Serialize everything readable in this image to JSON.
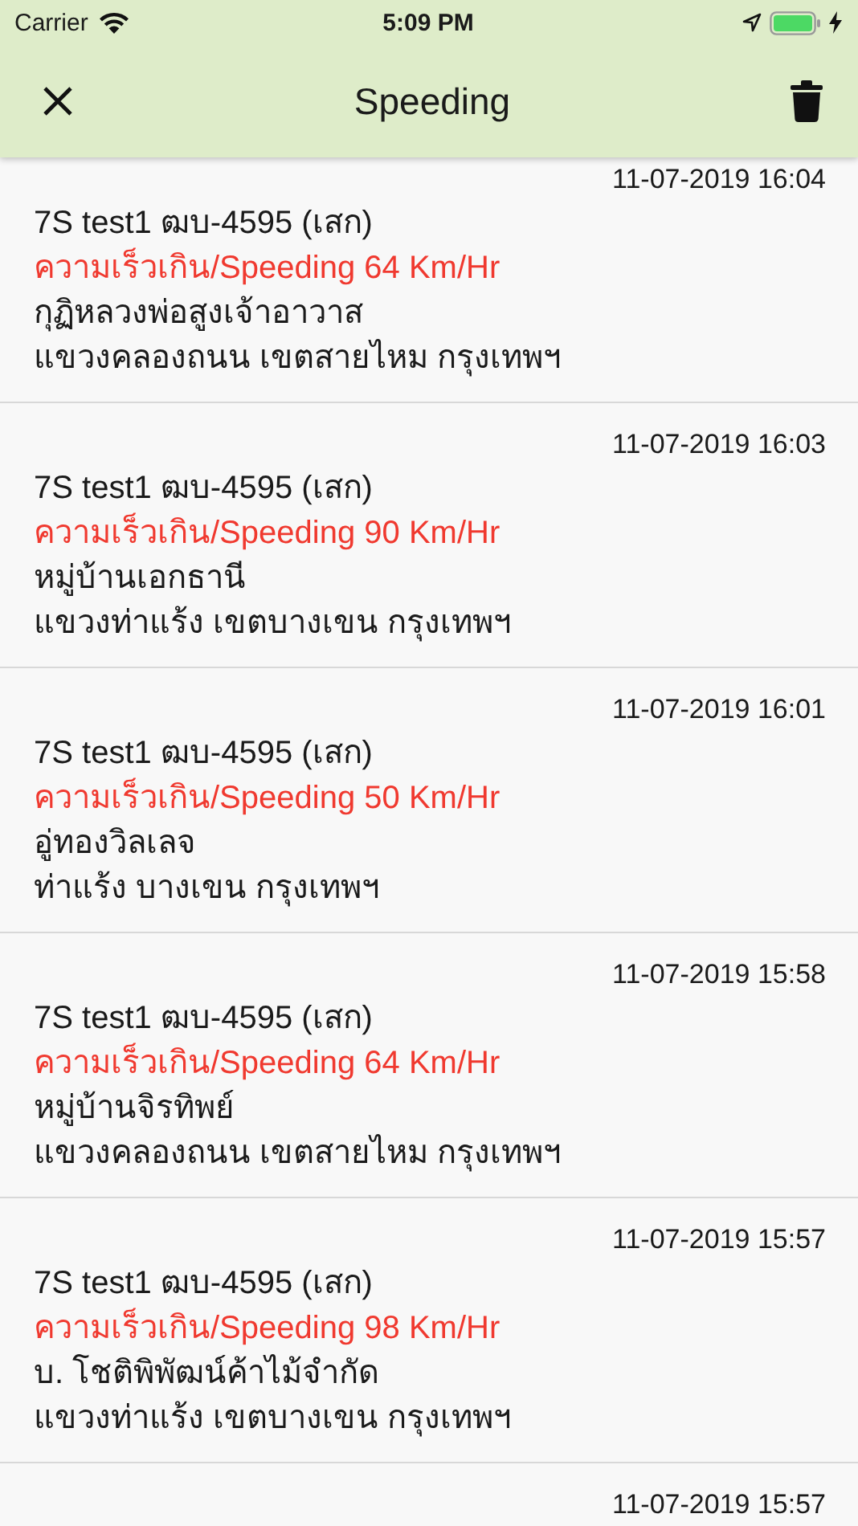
{
  "status_bar": {
    "carrier": "Carrier",
    "time": "5:09 PM"
  },
  "nav": {
    "title": "Speeding"
  },
  "alerts": [
    {
      "time": "11-07-2019 16:04",
      "vehicle": "7S test1 ฒบ-4595 (เสก)",
      "event": "ความเร็วเกิน/Speeding 64 Km/Hr",
      "place": "กุฏิหลวงพ่อสูงเจ้าอาวาส",
      "area": "แขวงคลองถนน เขตสายไหม กรุงเทพฯ"
    },
    {
      "time": "11-07-2019 16:03",
      "vehicle": "7S test1 ฒบ-4595 (เสก)",
      "event": "ความเร็วเกิน/Speeding 90 Km/Hr",
      "place": "หมู่บ้านเอกธานี",
      "area": "แขวงท่าแร้ง เขตบางเขน กรุงเทพฯ"
    },
    {
      "time": "11-07-2019 16:01",
      "vehicle": "7S test1 ฒบ-4595 (เสก)",
      "event": "ความเร็วเกิน/Speeding 50 Km/Hr",
      "place": "อู่ทองวิลเลจ",
      "area": "ท่าแร้ง บางเขน กรุงเทพฯ"
    },
    {
      "time": "11-07-2019 15:58",
      "vehicle": "7S test1 ฒบ-4595 (เสก)",
      "event": "ความเร็วเกิน/Speeding 64 Km/Hr",
      "place": "หมู่บ้านจิรทิพย์",
      "area": "แขวงคลองถนน เขตสายไหม กรุงเทพฯ"
    },
    {
      "time": "11-07-2019 15:57",
      "vehicle": "7S test1 ฒบ-4595 (เสก)",
      "event": "ความเร็วเกิน/Speeding 98 Km/Hr",
      "place": "บ. โชติพิพัฒน์ค้าไม้จำกัด",
      "area": "แขวงท่าแร้ง เขตบางเขน กรุงเทพฯ"
    },
    {
      "time": "11-07-2019 15:57"
    }
  ]
}
